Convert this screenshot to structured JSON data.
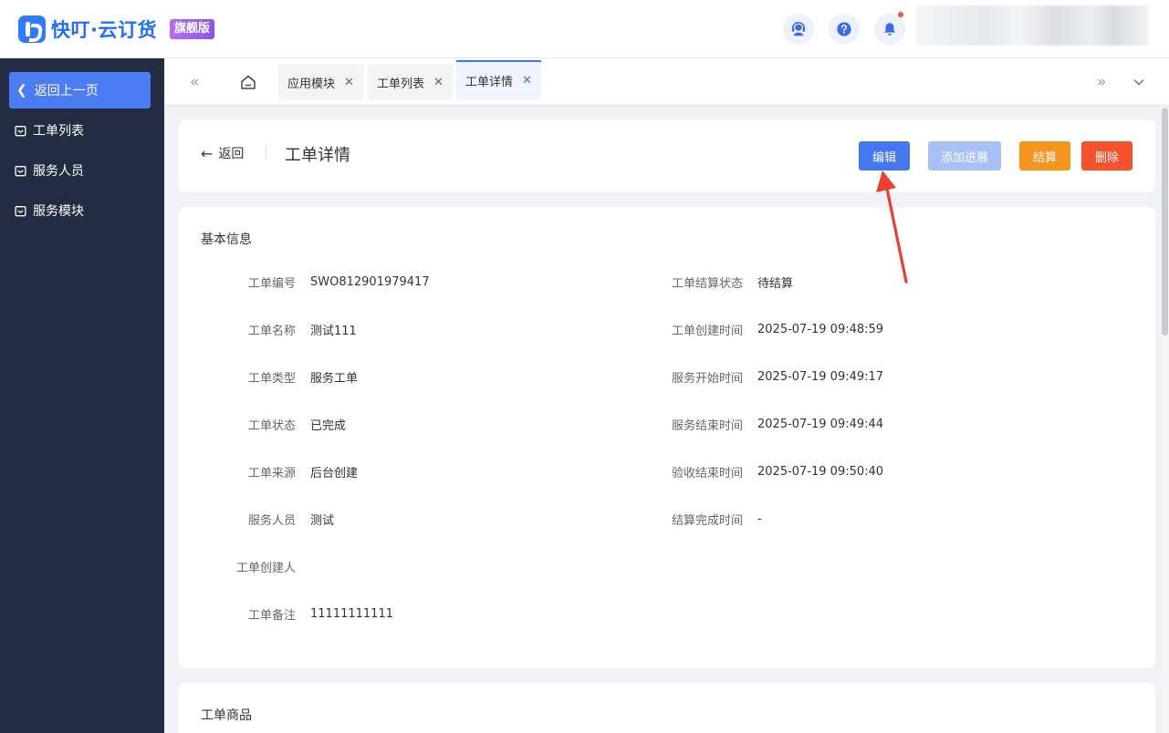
{
  "header": {
    "app_name": "快叮·云订货",
    "edition_badge": "旗舰版"
  },
  "sidebar": {
    "back_label": "返回上一页",
    "items": [
      {
        "label": "工单列表"
      },
      {
        "label": "服务人员"
      },
      {
        "label": "服务模块"
      }
    ]
  },
  "tabs": [
    {
      "label": "应用模块",
      "active": false
    },
    {
      "label": "工单列表",
      "active": false
    },
    {
      "label": "工单详情",
      "active": true
    }
  ],
  "page": {
    "back_label": "返回",
    "title": "工单详情",
    "actions": {
      "edit": "编辑",
      "add_progress": "添加进展",
      "settle": "结算",
      "delete": "删除"
    }
  },
  "basic_info": {
    "title": "基本信息",
    "left": [
      {
        "label": "工单编号",
        "value": "SWO812901979417"
      },
      {
        "label": "工单名称",
        "value": "测试111"
      },
      {
        "label": "工单类型",
        "value": "服务工单"
      },
      {
        "label": "工单状态",
        "value": "已完成"
      },
      {
        "label": "工单来源",
        "value": "后台创建"
      },
      {
        "label": "服务人员",
        "value": "测试"
      },
      {
        "label": "工单创建人",
        "value": ""
      },
      {
        "label": "工单备注",
        "value": "11111111111"
      }
    ],
    "right": [
      {
        "label": "工单结算状态",
        "value": "待结算"
      },
      {
        "label": "工单创建时间",
        "value": "2025-07-19 09:48:59"
      },
      {
        "label": "服务开始时间",
        "value": "2025-07-19 09:49:17"
      },
      {
        "label": "服务结束时间",
        "value": "2025-07-19 09:49:44"
      },
      {
        "label": "验收结束时间",
        "value": "2025-07-19 09:50:40"
      },
      {
        "label": "结算完成时间",
        "value": "-"
      }
    ]
  },
  "goods": {
    "title": "工单商品"
  },
  "colors": {
    "primary": "#4577f0",
    "sidebar_bg": "#232c43",
    "settle": "#f7961e",
    "delete": "#f4512c",
    "annotation": "#e8412f"
  }
}
